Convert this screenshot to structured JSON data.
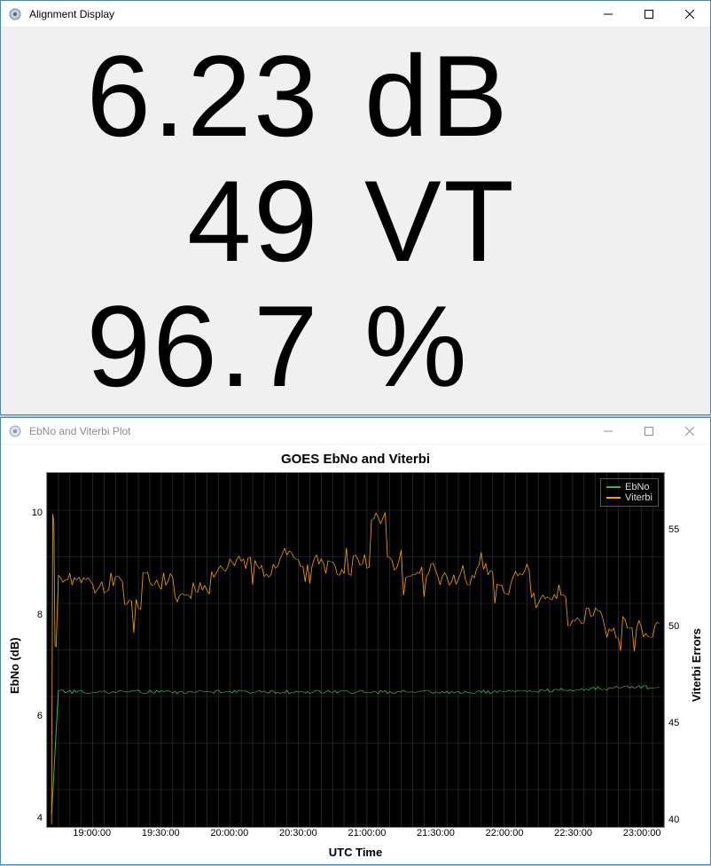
{
  "window1": {
    "title": "Alignment Display",
    "rows": {
      "ebNo": {
        "value": "6.23",
        "unit": "dB"
      },
      "vt": {
        "value": "49",
        "unit": "VT"
      },
      "pct": {
        "value": "96.7",
        "unit": "%"
      }
    }
  },
  "window2": {
    "title": "EbNo and Viterbi Plot",
    "chartTitle": "GOES EbNo and Viterbi",
    "xlabel": "UTC Time",
    "ylabelLeft": "EbNo (dB)",
    "ylabelRight": "Viterbi Errors",
    "legend": {
      "s1": "EbNo",
      "s2": "Viterbi"
    },
    "colors": {
      "ebno": "#37b24d",
      "viterbi": "#f59f00"
    }
  },
  "chart_data": {
    "type": "line",
    "title": "GOES EbNo and Viterbi",
    "xlabel": "UTC Time",
    "x_ticks": [
      "19:00:00",
      "19:30:00",
      "20:00:00",
      "20:30:00",
      "21:00:00",
      "21:30:00",
      "22:00:00",
      "22:30:00",
      "23:00:00"
    ],
    "x_range_minutes": [
      1120,
      1390
    ],
    "left_axis": {
      "label": "EbNo (dB)",
      "ticks": [
        4,
        6,
        8,
        10
      ],
      "range": [
        3.2,
        10.8
      ]
    },
    "right_axis": {
      "label": "Viterbi Errors",
      "ticks": [
        40,
        45,
        50,
        55
      ],
      "range": [
        38,
        58
      ]
    },
    "series": [
      {
        "name": "EbNo",
        "axis": "left",
        "color": "#37b24d",
        "x_minutes": [
          1122,
          1125,
          1140,
          1170,
          1200,
          1230,
          1260,
          1290,
          1320,
          1350,
          1380,
          1388
        ],
        "y": [
          3.5,
          6.1,
          6.1,
          6.1,
          6.1,
          6.1,
          6.1,
          6.1,
          6.1,
          6.15,
          6.2,
          6.2
        ]
      },
      {
        "name": "Viterbi",
        "axis": "right",
        "color": "#f59f00",
        "x_minutes": [
          1122,
          1123,
          1124,
          1126,
          1135,
          1145,
          1150,
          1158,
          1165,
          1172,
          1180,
          1188,
          1195,
          1202,
          1210,
          1218,
          1225,
          1230,
          1236,
          1242,
          1250,
          1258,
          1265,
          1272,
          1280,
          1288,
          1296,
          1304,
          1312,
          1320,
          1328,
          1336,
          1344,
          1352,
          1360,
          1368,
          1376,
          1384,
          1388
        ],
        "y": [
          38.5,
          55.5,
          48,
          52,
          52,
          51.5,
          52,
          50.5,
          52,
          52,
          51,
          51.5,
          52.5,
          53,
          53,
          52.5,
          53.5,
          53,
          53,
          53,
          52.5,
          53,
          55.5,
          53,
          52,
          52.5,
          52,
          52,
          52.5,
          51.5,
          52.5,
          51,
          51,
          49.5,
          50,
          49,
          49.5,
          49,
          49.5
        ]
      }
    ],
    "legend_position": "top-right"
  }
}
